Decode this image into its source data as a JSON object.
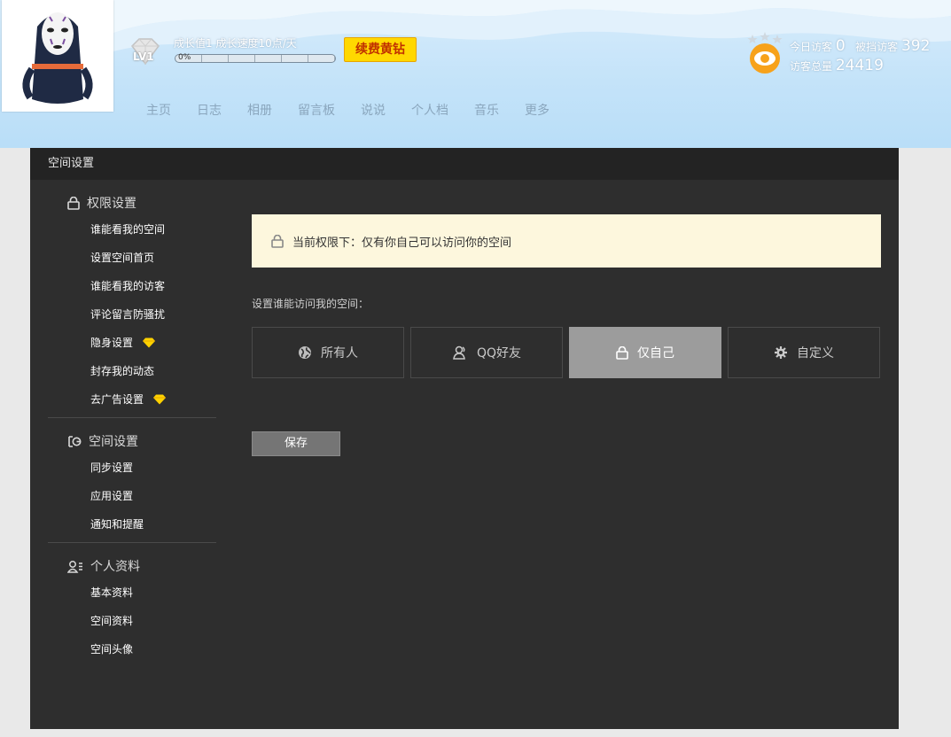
{
  "header": {
    "level": "LV1",
    "growth_text": "成长值1  成长速度10点/天",
    "progress_label": "0%",
    "progress_value": 0,
    "renew_label": "续费黄钻",
    "nav": [
      "主页",
      "日志",
      "相册",
      "留言板",
      "说说",
      "个人档",
      "音乐",
      "更多"
    ],
    "visitors": {
      "today_label": "今日访客",
      "today_value": "0",
      "blocked_label": "被挡访客",
      "blocked_value": "392",
      "total_label": "访客总量",
      "total_value": "24419"
    }
  },
  "panel": {
    "title": "空间设置",
    "sidebar": {
      "groups": [
        {
          "title": "权限设置",
          "icon": "lock-icon",
          "items": [
            "谁能看我的空间",
            "设置空间首页",
            "谁能看我的访客",
            "评论留言防骚扰",
            "隐身设置",
            "封存我的动态",
            "去广告设置"
          ]
        },
        {
          "title": "空间设置",
          "icon": "space-settings-icon",
          "items": [
            "同步设置",
            "应用设置",
            "通知和提醒"
          ]
        },
        {
          "title": "个人资料",
          "icon": "profile-icon",
          "items": [
            "基本资料",
            "空间资料",
            "空间头像"
          ]
        }
      ]
    },
    "notice": "当前权限下：仅有你自己可以访问你的空间",
    "setting_label": "设置谁能访问我的空间：",
    "options": [
      {
        "label": "所有人",
        "icon": "globe-icon",
        "selected": false
      },
      {
        "label": "QQ好友",
        "icon": "friends-icon",
        "selected": false
      },
      {
        "label": "仅自己",
        "icon": "lock-icon",
        "selected": true
      },
      {
        "label": "自定义",
        "icon": "gear-icon",
        "selected": false
      }
    ],
    "save_label": "保存"
  },
  "colors": {
    "accent_gold": "#ffd800",
    "panel_bg": "#2e2e2e",
    "notice_bg": "#fdf7dd",
    "selected_option": "#9c9c9c"
  }
}
